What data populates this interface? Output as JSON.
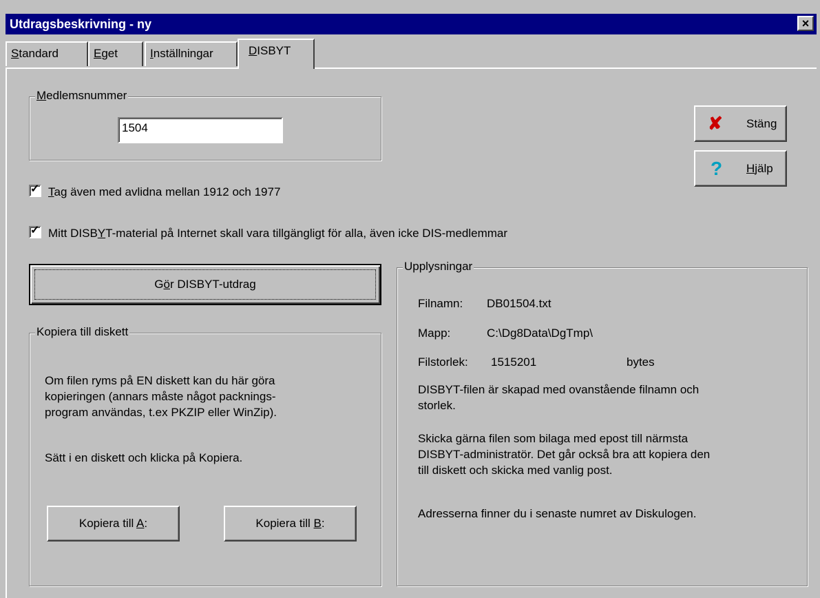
{
  "window": {
    "title": "Utdragsbeskrivning - ny",
    "close_label": "×"
  },
  "tabs": [
    {
      "pre": "",
      "key": "S",
      "post": "tandard"
    },
    {
      "pre": "",
      "key": "E",
      "post": "get"
    },
    {
      "pre": "",
      "key": "I",
      "post": "nställningar"
    },
    {
      "pre": "",
      "key": "D",
      "post": "ISBYT"
    }
  ],
  "member": {
    "group_label_key": "M",
    "group_label_rest": "edlemsnummer",
    "value": "1504"
  },
  "checkboxes": [
    {
      "checked": true,
      "pre": "",
      "key": "T",
      "post": "ag även med avlidna mellan 1912 och 1977"
    },
    {
      "checked": true,
      "pre": "Mitt DISB",
      "key": "Y",
      "post": "T-material på Internet skall vara tillgängligt för alla, även icke DIS-medlemmar"
    }
  ],
  "make_button": {
    "pre": "G",
    "key": "ö",
    "post": "r DISBYT-utdrag"
  },
  "close_button": {
    "label": "Stäng",
    "icon": "red-x-icon",
    "icon_color": "#cc0000"
  },
  "help_button": {
    "key": "H",
    "post": "jälp",
    "icon": "question-icon",
    "icon_color": "#00a0c0"
  },
  "copy_group": {
    "label": "Kopiera till diskett",
    "text1_lines": [
      "Om filen ryms på EN diskett kan du här göra",
      "kopieringen (annars måste något packnings-",
      "program användas, t.ex PKZIP eller WinZip)."
    ],
    "text2": "Sätt i en diskett och klicka på Kopiera.",
    "btn_a": {
      "pre": "Kopiera till ",
      "key": "A",
      "post": ":"
    },
    "btn_b": {
      "pre": "Kopiera till ",
      "key": "B",
      "post": ":"
    }
  },
  "info_group": {
    "label": "Upplysningar",
    "filename_label": "Filnamn:",
    "filename_value": "DB01504.txt",
    "folder_label": "Mapp:",
    "folder_value": "C:\\Dg8Data\\DgTmp\\",
    "size_label": "Filstorlek:",
    "size_value": "1515201",
    "size_unit": "bytes",
    "para1_lines": [
      "DISBYT-filen är skapad med ovanstående filnamn och",
      "storlek."
    ],
    "para2_lines": [
      "Skicka gärna filen som bilaga med epost till närmsta",
      "DISBYT-administratör. Det går också bra att kopiera den",
      "till diskett och skicka med vanlig post."
    ],
    "para3": "Adresserna finner du i senaste numret av Diskulogen."
  }
}
